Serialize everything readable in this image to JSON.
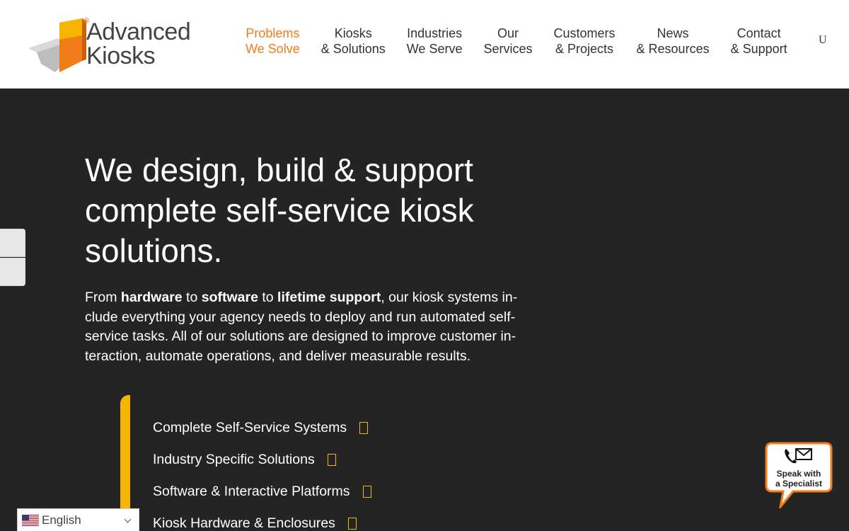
{
  "brand": {
    "name_line1": "Advanced",
    "name_line2": "Kiosks",
    "registered": "®",
    "colors": {
      "orange": "#f07d1a",
      "yellow": "#f8b500",
      "dark": "#242424"
    }
  },
  "nav": {
    "items": [
      {
        "line1": "Problems",
        "line2": "We Solve",
        "active": true
      },
      {
        "line1": "Kiosks",
        "line2": "& Solutions",
        "active": false
      },
      {
        "line1": "Industries",
        "line2": "We Serve",
        "active": false
      },
      {
        "line1": "Our",
        "line2": "Services",
        "active": false
      },
      {
        "line1": "Customers",
        "line2": "& Projects",
        "active": false
      },
      {
        "line1": "News",
        "line2": "& Resources",
        "active": false
      },
      {
        "line1": "Contact",
        "line2": "& Support",
        "active": false
      }
    ],
    "extra": "U"
  },
  "hero": {
    "title": "We design, build & support complete self-service kiosk solutions.",
    "body": {
      "t1": "From ",
      "b1": "hardware",
      "t2": " to ",
      "b2": "software",
      "t3": " to ",
      "b3": "lifetime support",
      "t4": ", our kiosk systems in­clude everything your agency needs to deploy and run automated self-service tasks. All of our solutions are designed to improve customer in­teraction, automate operations, and deliver measurable results."
    },
    "links": [
      "Complete Self-Service Systems",
      "Industry Specific Solutions",
      "Software & Interactive Platforms",
      "Kiosk Hardware & Enclosures"
    ]
  },
  "language": {
    "selected": "English",
    "flag": "us-flag-icon"
  },
  "specialist": {
    "line1": "Speak with",
    "line2": "a Specialist",
    "icon": "phone-envelope-icon"
  }
}
